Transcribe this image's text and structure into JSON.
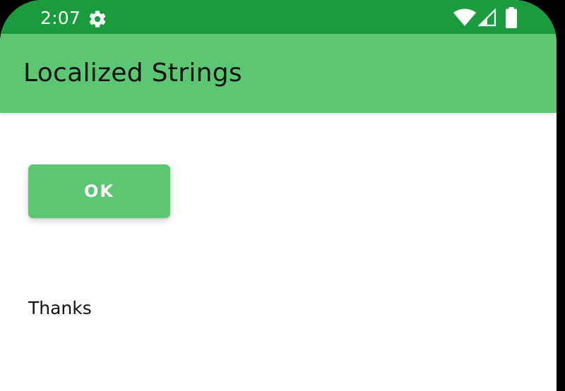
{
  "status_bar": {
    "time": "2:07",
    "icons": [
      "gear-icon",
      "wifi-icon",
      "signal-icon",
      "battery-icon"
    ]
  },
  "app_bar": {
    "title": "Localized Strings"
  },
  "main": {
    "button_label": "OK",
    "message": "Thanks"
  },
  "colors": {
    "status_bar": "#1a9b3e",
    "primary": "#5cc672",
    "background": "#ffffff",
    "text": "#111111",
    "on_primary": "#ffffff"
  }
}
